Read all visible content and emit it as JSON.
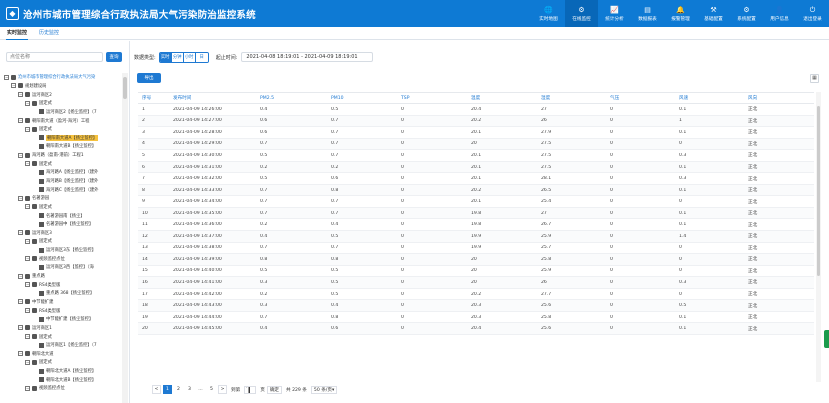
{
  "header": {
    "title": "沧州市城市管理综合行政执法局大气污染防治监控系统",
    "nav": [
      {
        "label": "实时地图",
        "icon": "globe-icon",
        "glyph": "🌐",
        "active": false
      },
      {
        "label": "在线监控",
        "icon": "gears-icon",
        "glyph": "⚙",
        "active": true
      },
      {
        "label": "统计分析",
        "icon": "chart-line-icon",
        "glyph": "📈",
        "active": false
      },
      {
        "label": "数据报表",
        "icon": "report-icon",
        "glyph": "▤",
        "active": false
      },
      {
        "label": "报警管理",
        "icon": "bell-icon",
        "glyph": "🔔",
        "active": false
      },
      {
        "label": "基础配置",
        "icon": "config-icon",
        "glyph": "⚒",
        "active": false
      },
      {
        "label": "系统配置",
        "icon": "system-icon",
        "glyph": "⚙",
        "active": false
      },
      {
        "label": "用户信息",
        "icon": "user-icon",
        "glyph": "👤",
        "active": false
      },
      {
        "label": "退出登录",
        "icon": "power-icon",
        "glyph": "⏻",
        "active": false
      }
    ]
  },
  "tabs": {
    "realtime": "实时监控",
    "history": "历史监控"
  },
  "left": {
    "search_placeholder": "点位名称",
    "search_button": "查询",
    "tree": [
      {
        "level": 0,
        "toggle": "−",
        "icon": "folder",
        "label": "沧州市城市管理综合行政执法局大气污染",
        "root": true
      },
      {
        "level": 1,
        "toggle": "−",
        "icon": "folder",
        "label": "规划建设局"
      },
      {
        "level": 2,
        "toggle": "−",
        "icon": "folder",
        "label": "运河商区2"
      },
      {
        "level": 3,
        "toggle": "−",
        "icon": "folder",
        "label": "固定式"
      },
      {
        "level": 4,
        "toggle": "",
        "icon": "file",
        "label": "运河商区2【扬尘监控】（7"
      },
      {
        "level": 2,
        "toggle": "−",
        "icon": "folder",
        "label": "朝阳南大道（盈河-海河）工程"
      },
      {
        "level": 3,
        "toggle": "−",
        "icon": "folder",
        "label": "固定式"
      },
      {
        "level": 4,
        "toggle": "",
        "icon": "file",
        "label": "朝阳南大道A【扬尘监控】",
        "selected": true
      },
      {
        "level": 4,
        "toggle": "",
        "icon": "file",
        "label": "朝阳南大道B【扬尘监控】"
      },
      {
        "level": 2,
        "toggle": "−",
        "icon": "folder",
        "label": "海河路（盈南-港前）工程1"
      },
      {
        "level": 3,
        "toggle": "−",
        "icon": "folder",
        "label": "固定式"
      },
      {
        "level": 4,
        "toggle": "",
        "icon": "file",
        "label": "海河路A【扬尘监控】（建外"
      },
      {
        "level": 4,
        "toggle": "",
        "icon": "file",
        "label": "海河路B【扬尘监控】（建外"
      },
      {
        "level": 4,
        "toggle": "",
        "icon": "file",
        "label": "海河路C【扬尘监控】（建外"
      },
      {
        "level": 2,
        "toggle": "−",
        "icon": "folder",
        "label": "名著游园"
      },
      {
        "level": 3,
        "toggle": "−",
        "icon": "folder",
        "label": "固定式"
      },
      {
        "level": 4,
        "toggle": "",
        "icon": "file",
        "label": "名著游园南【扬尘】"
      },
      {
        "level": 4,
        "toggle": "",
        "icon": "file",
        "label": "名著游园中【扬尘监控】"
      },
      {
        "level": 2,
        "toggle": "−",
        "icon": "folder",
        "label": "运河商区3"
      },
      {
        "level": 3,
        "toggle": "−",
        "icon": "folder",
        "label": "固定式"
      },
      {
        "level": 4,
        "toggle": "",
        "icon": "file",
        "label": "运河商区3东【扬尘监控】"
      },
      {
        "level": 3,
        "toggle": "−",
        "icon": "folder",
        "label": "视频监控点位"
      },
      {
        "level": 4,
        "toggle": "",
        "icon": "file",
        "label": "运河商区3西【监控】（海"
      },
      {
        "level": 2,
        "toggle": "−",
        "icon": "folder",
        "label": "重点路"
      },
      {
        "level": 3,
        "toggle": "−",
        "icon": "folder",
        "label": "RS4类型版"
      },
      {
        "level": 4,
        "toggle": "",
        "icon": "file",
        "label": "重点路 368【扬尘监控】"
      },
      {
        "level": 2,
        "toggle": "−",
        "icon": "folder",
        "label": "中节能扩建"
      },
      {
        "level": 3,
        "toggle": "−",
        "icon": "folder",
        "label": "RS4类型版"
      },
      {
        "level": 4,
        "toggle": "",
        "icon": "file",
        "label": "中节能扩建【扬尘监控】"
      },
      {
        "level": 2,
        "toggle": "−",
        "icon": "folder",
        "label": "运河商区1"
      },
      {
        "level": 3,
        "toggle": "−",
        "icon": "folder",
        "label": "固定式"
      },
      {
        "level": 4,
        "toggle": "",
        "icon": "file",
        "label": "运河商区1【扬尘监控】（7"
      },
      {
        "level": 2,
        "toggle": "−",
        "icon": "folder",
        "label": "朝阳北大道"
      },
      {
        "level": 3,
        "toggle": "−",
        "icon": "folder",
        "label": "固定式"
      },
      {
        "level": 4,
        "toggle": "",
        "icon": "file",
        "label": "朝阳北大道A【扬尘监控】"
      },
      {
        "level": 4,
        "toggle": "",
        "icon": "file",
        "label": "朝阳北大道B【扬尘监控】"
      },
      {
        "level": 3,
        "toggle": "−",
        "icon": "folder",
        "label": "视频监控点位"
      }
    ]
  },
  "filter": {
    "type_label": "数据类型:",
    "types": [
      {
        "label": "实时",
        "on": true
      },
      {
        "label": "分钟",
        "on": false
      },
      {
        "label": "小时",
        "on": false
      },
      {
        "label": "日",
        "on": false
      }
    ],
    "range_label": "起止时间:",
    "range_value": "2021-04-08 18:19:01 - 2021-04-09 18:19:01"
  },
  "toolbar": {
    "export_label": "导出",
    "columns_icon": "columns-icon"
  },
  "table": {
    "headers": [
      "序号",
      "发布时间",
      "PM2.5",
      "PM10",
      "TSP",
      "温度",
      "湿度",
      "气压",
      "风速",
      "风向"
    ],
    "rows": [
      [
        "1",
        "2021-04-09 14:26:00",
        "0.4",
        "0.5",
        "0",
        "20.4",
        "27",
        "0",
        "0.1",
        "正北"
      ],
      [
        "2",
        "2021-04-09 14:27:00",
        "0.6",
        "0.7",
        "0",
        "20.2",
        "26",
        "0",
        "1",
        "正北"
      ],
      [
        "3",
        "2021-04-09 14:28:00",
        "0.6",
        "0.7",
        "0",
        "20.1",
        "27.9",
        "0",
        "0.1",
        "正北"
      ],
      [
        "4",
        "2021-04-09 14:29:00",
        "0.7",
        "0.7",
        "0",
        "20",
        "27.5",
        "0",
        "0",
        "正北"
      ],
      [
        "5",
        "2021-04-09 14:30:00",
        "0.5",
        "0.7",
        "0",
        "20.1",
        "27.5",
        "0",
        "0.3",
        "正北"
      ],
      [
        "6",
        "2021-04-09 14:31:00",
        "0.2",
        "0.2",
        "0",
        "20.1",
        "27.5",
        "0",
        "0.1",
        "正北"
      ],
      [
        "7",
        "2021-04-09 14:32:00",
        "0.5",
        "0.6",
        "0",
        "20.1",
        "28.1",
        "0",
        "0.3",
        "正北"
      ],
      [
        "8",
        "2021-04-09 14:33:00",
        "0.7",
        "0.8",
        "0",
        "20.2",
        "26.5",
        "0",
        "0.1",
        "正北"
      ],
      [
        "9",
        "2021-04-09 14:34:00",
        "0.7",
        "0.7",
        "0",
        "20.1",
        "25.4",
        "0",
        "0",
        "正北"
      ],
      [
        "10",
        "2021-04-09 14:35:00",
        "0.7",
        "0.7",
        "0",
        "19.8",
        "27",
        "0",
        "0.1",
        "正北"
      ],
      [
        "11",
        "2021-04-09 14:36:00",
        "0.2",
        "0.4",
        "0",
        "19.8",
        "26.7",
        "0",
        "0.1",
        "正北"
      ],
      [
        "12",
        "2021-04-09 14:37:00",
        "0.4",
        "0.5",
        "0",
        "19.9",
        "25.9",
        "0",
        "1.4",
        "正北"
      ],
      [
        "13",
        "2021-04-09 14:38:00",
        "0.7",
        "0.7",
        "0",
        "19.9",
        "25.7",
        "0",
        "0",
        "正北"
      ],
      [
        "14",
        "2021-04-09 14:39:00",
        "0.8",
        "0.8",
        "0",
        "20",
        "25.8",
        "0",
        "0",
        "正北"
      ],
      [
        "15",
        "2021-04-09 14:40:00",
        "0.5",
        "0.5",
        "0",
        "20",
        "25.9",
        "0",
        "0",
        "正北"
      ],
      [
        "16",
        "2021-04-09 14:41:00",
        "0.3",
        "0.5",
        "0",
        "20",
        "26",
        "0",
        "0.3",
        "正北"
      ],
      [
        "17",
        "2021-04-09 14:42:00",
        "0.2",
        "0.5",
        "0",
        "20.2",
        "27.7",
        "0",
        "0",
        "正北"
      ],
      [
        "18",
        "2021-04-09 14:43:00",
        "0.3",
        "0.4",
        "0",
        "20.3",
        "25.6",
        "0",
        "0.5",
        "正北"
      ],
      [
        "19",
        "2021-04-09 14:44:00",
        "0.7",
        "0.8",
        "0",
        "20.3",
        "25.8",
        "0",
        "0.1",
        "正北"
      ],
      [
        "20",
        "2021-04-09 14:45:00",
        "0.4",
        "0.6",
        "0",
        "20.4",
        "25.6",
        "0",
        "0.1",
        "正北"
      ]
    ]
  },
  "pager": {
    "prev": "<",
    "pages": [
      "1",
      "2",
      "3",
      "...",
      "5"
    ],
    "next": ">",
    "goto_label": "到第",
    "goto_value": "1",
    "page_unit": "页",
    "confirm": "确定",
    "total": "共 229 条",
    "per_page": "50 条/页",
    "per_page_arrow": "▾"
  }
}
